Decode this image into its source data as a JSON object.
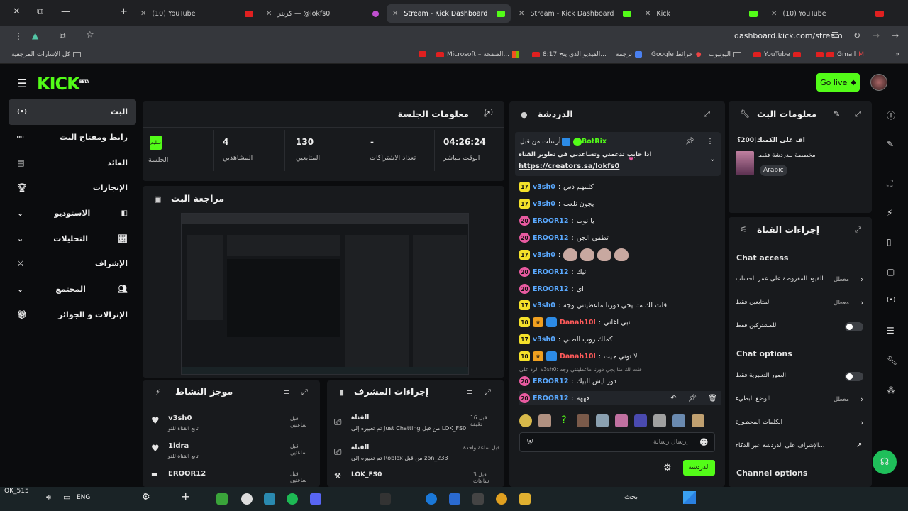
{
  "browser": {
    "tabs": [
      {
        "title": "(10) YouTube",
        "icon_color": "#e02020"
      },
      {
        "title": "کریتر — @lokfs0",
        "icon_color": "#c04fd0"
      },
      {
        "title": "Stream - Kick Dashboard",
        "icon_color": "#53fc18"
      },
      {
        "title": "Stream - Kick Dashboard",
        "icon_color": "#53fc18"
      },
      {
        "title": "Kick",
        "icon_color": "#53fc18"
      },
      {
        "title": "(10) YouTube",
        "icon_color": "#e02020"
      }
    ],
    "url": "dashboard.kick.com/stream",
    "bookmarks": [
      "كل الإشارات المرجعية",
      "Microsoft – الصفحة...",
      "8:17 الفيديو الذي يتح...",
      "ترجمة",
      "Google خرائط",
      "اليوتيوب",
      "YouTube",
      "Gmail"
    ]
  },
  "header": {
    "logo": "KICK",
    "logo_tag": "BETA",
    "golive_label": "Go live"
  },
  "sidebar": {
    "items": [
      {
        "label": "البث",
        "active": true
      },
      {
        "label": "رابط ومفتاح البث"
      },
      {
        "label": "العائد"
      },
      {
        "label": "الإنجازات"
      },
      {
        "label": "الاستوديو"
      },
      {
        "label": "التحليلات"
      },
      {
        "label": "الإشراف"
      },
      {
        "label": "المجتمع"
      },
      {
        "label": "الإنزالات و الجوائز"
      }
    ]
  },
  "session": {
    "title": "معلومات الجلسة",
    "status_badge": "سليم",
    "stats": [
      {
        "label": "الجلسة",
        "value": ""
      },
      {
        "label": "المشاهدين",
        "value": "4"
      },
      {
        "label": "المتابعين",
        "value": "130"
      },
      {
        "label": "تعداد الاشتراكات",
        "value": "-"
      },
      {
        "label": "الوقت مباشر",
        "value": "04:26:24"
      }
    ]
  },
  "preview": {
    "title": "مراجعة البث"
  },
  "activity": {
    "title": "موجز النشاط",
    "items": [
      {
        "user": "v3sh0",
        "desc": "تابع القناة للتو",
        "time": "قبل ساعتين"
      },
      {
        "user": "1idra",
        "desc": "تابع القناة للتو",
        "time": "قبل ساعتين"
      },
      {
        "user": "EROOR12",
        "desc": "",
        "time": "قبل ساعتين"
      }
    ]
  },
  "modactions": {
    "title": "إجراءات المشرف",
    "items": [
      {
        "head": "القناة",
        "text": "تم تغييره إلى Just Chatting من قبل LOK_FS0",
        "time": "قبل 16 دقيقة"
      },
      {
        "head": "القناة",
        "text": "تم تغييره إلى Roblox من قبل zon_233",
        "time": "قبل ساعة واحدة"
      },
      {
        "head": "LOK_FS0",
        "text": "",
        "time": "قبل 3 ساعات"
      }
    ]
  },
  "chat": {
    "title": "الدردشة",
    "pinned": {
      "by": "أرسلت من قبل",
      "user": "BotRix",
      "text": "اذا حابب تدعمني وتساعدني في تطوير القناة",
      "link": "https://creators.sa/lokfs0"
    },
    "messages": [
      {
        "badge": "17",
        "user": "v3sh0",
        "color": "#5aa9ff",
        "text": "كلمهم دس"
      },
      {
        "badge": "17",
        "user": "v3sh0",
        "color": "#5aa9ff",
        "text": "يجون نلعب"
      },
      {
        "badge": "20",
        "user": "EROOR12",
        "color": "#5aa9ff",
        "text": "يا نوب"
      },
      {
        "badge": "20",
        "user": "EROOR12",
        "color": "#5aa9ff",
        "text": "تطفي الجن"
      },
      {
        "badge": "17",
        "user": "v3sh0",
        "color": "#5aa9ff",
        "text": ""
      },
      {
        "badge": "20",
        "user": "EROOR12",
        "color": "#5aa9ff",
        "text": "تيك"
      },
      {
        "badge": "20",
        "user": "EROOR12",
        "color": "#5aa9ff",
        "text": "اي"
      },
      {
        "badge": "17",
        "user": "v3sh0",
        "color": "#5aa9ff",
        "text": "قلت لك متا يجي دورنا ماعطيتني وجه"
      },
      {
        "badge": "10",
        "user": "Danah10l",
        "color": "#ff5a5a",
        "text": "نبي اغاني"
      },
      {
        "badge": "17",
        "user": "v3sh0",
        "color": "#5aa9ff",
        "text": "كملك روب الطبي"
      },
      {
        "badge": "10",
        "user": "Danah10l",
        "color": "#ff5a5a",
        "text": "لا توني جيت"
      }
    ],
    "reply_hint": "الرد على v3sh0: قلت لك متا يجي دورنا ماعطيتني وجه",
    "reply_msg": {
      "badge": "20",
      "user": "EROOR12",
      "text": "دور ايش البيك"
    },
    "last_msg": {
      "badge": "20",
      "user": "EROOR12",
      "text": "هههه"
    },
    "input_placeholder": "إرسال رسالة",
    "send_label": "الدردشة"
  },
  "streaminfo": {
    "title": "معلومات البث",
    "stream_title": "اف على الكمبك|200؟",
    "category": "مخصصة للدردشة فقط",
    "language": "Arabic"
  },
  "channel": {
    "title": "إجراءات القناة",
    "chat_access": "Chat access",
    "rows": [
      {
        "label": "القيود المفروضة على عمر الحساب",
        "state": "معطل"
      },
      {
        "label": "المتابعين فقط",
        "state": "معطل"
      },
      {
        "label": "للمشتركين فقط",
        "state": ""
      }
    ],
    "chat_options": "Chat options",
    "opt_rows": [
      {
        "label": "الصور التعبيرية فقط",
        "state": ""
      },
      {
        "label": "الوضع البطيء",
        "state": "معطل"
      },
      {
        "label": "الكلمات المحظورة",
        "state": ""
      },
      {
        "label": "الإشراف على الدردشة عبر الذكاء...",
        "state": ""
      }
    ],
    "channel_options": "Channel options"
  },
  "taskbar": {
    "search_label": "بحث",
    "lang": "ENG",
    "clock": "OK_515"
  }
}
